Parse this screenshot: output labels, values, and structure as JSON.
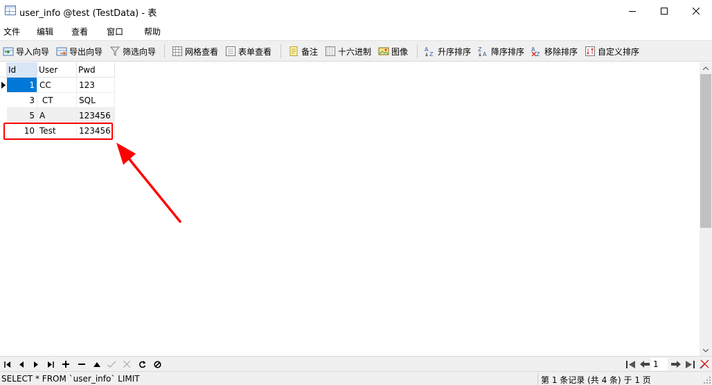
{
  "window": {
    "title": "user_info @test (TestData) - 表"
  },
  "menu": [
    {
      "label": "文件"
    },
    {
      "label": "编辑"
    },
    {
      "label": "查看"
    },
    {
      "label": "窗口"
    },
    {
      "label": "帮助"
    }
  ],
  "toolbar": {
    "import_wizard": "导入向导",
    "export_wizard": "导出向导",
    "filter_wizard": "筛选向导",
    "grid_view": "网格查看",
    "form_view": "表单查看",
    "memo": "备注",
    "hex": "十六进制",
    "image": "图像",
    "sort_asc": "升序排序",
    "sort_desc": "降序排序",
    "remove_sort": "移除排序",
    "custom_sort": "自定义排序"
  },
  "grid": {
    "columns": [
      "Id",
      "User",
      "Pwd"
    ],
    "rows": [
      {
        "id": "1",
        "user": "CC",
        "pwd": "123"
      },
      {
        "id": "3",
        "user": " CT",
        "pwd": "SQL"
      },
      {
        "id": "5",
        "user": "A",
        "pwd": "123456"
      },
      {
        "id": "10",
        "user": "Test",
        "pwd": "123456"
      }
    ]
  },
  "navigator": {
    "page": "1"
  },
  "status": {
    "sql": "SELECT * FROM `user_info` LIMIT",
    "records": "第 1 条记录 (共 4 条) 于 1 页"
  },
  "colors": {
    "selection": "#0078d7",
    "header_selected": "#d8e6f6",
    "annotation": "#ff0000",
    "chrome": "#f0f0f0"
  },
  "icons": [
    "table-icon",
    "minimize-icon",
    "maximize-icon",
    "close-icon",
    "import-icon",
    "export-icon",
    "filter-icon",
    "grid-icon",
    "form-icon",
    "memo-icon",
    "hex-icon",
    "image-icon",
    "sort-asc-icon",
    "sort-desc-icon",
    "remove-sort-icon",
    "custom-sort-icon"
  ]
}
